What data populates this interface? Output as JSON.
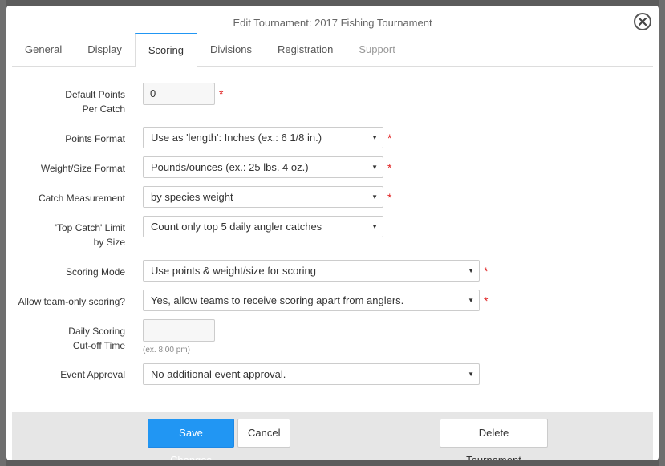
{
  "modal": {
    "title": "Edit Tournament: 2017 Fishing Tournament"
  },
  "tabs": [
    {
      "label": "General"
    },
    {
      "label": "Display"
    },
    {
      "label": "Scoring"
    },
    {
      "label": "Divisions"
    },
    {
      "label": "Registration"
    },
    {
      "label": "Support"
    }
  ],
  "active_tab": "Scoring",
  "form": {
    "default_points": {
      "label_line1": "Default Points",
      "label_line2": "Per Catch",
      "value": "0",
      "required": "*"
    },
    "points_format": {
      "label": "Points Format",
      "value": "Use as 'length': Inches (ex.: 6 1/8 in.)",
      "required": "*"
    },
    "weight_format": {
      "label": "Weight/Size Format",
      "value": "Pounds/ounces (ex.: 25 lbs. 4 oz.)",
      "required": "*"
    },
    "catch_measurement": {
      "label": "Catch Measurement",
      "value": "by species weight",
      "required": "*"
    },
    "top_catch_limit": {
      "label_line1": "'Top Catch' Limit",
      "label_line2": "by Size",
      "value": "Count only top 5 daily angler catches"
    },
    "scoring_mode": {
      "label": "Scoring Mode",
      "value": "Use points & weight/size for scoring",
      "required": "*"
    },
    "team_scoring": {
      "label": "Allow team-only scoring?",
      "value": "Yes, allow teams to receive scoring apart from anglers.",
      "required": "*"
    },
    "cutoff_time": {
      "label_line1": "Daily Scoring",
      "label_line2": "Cut-off Time",
      "value": "",
      "hint": "(ex. 8:00 pm)"
    },
    "event_approval": {
      "label": "Event Approval",
      "value": "No additional event approval."
    }
  },
  "footer": {
    "save_label": "Save Changes",
    "cancel_label": "Cancel",
    "delete_label": "Delete Tournament"
  },
  "colors": {
    "primary": "#2196f3",
    "required": "#e02020",
    "footer_bg": "#e6e6e6"
  },
  "icons": {
    "close": "close-icon",
    "dropdown": "chevron-down-icon"
  }
}
